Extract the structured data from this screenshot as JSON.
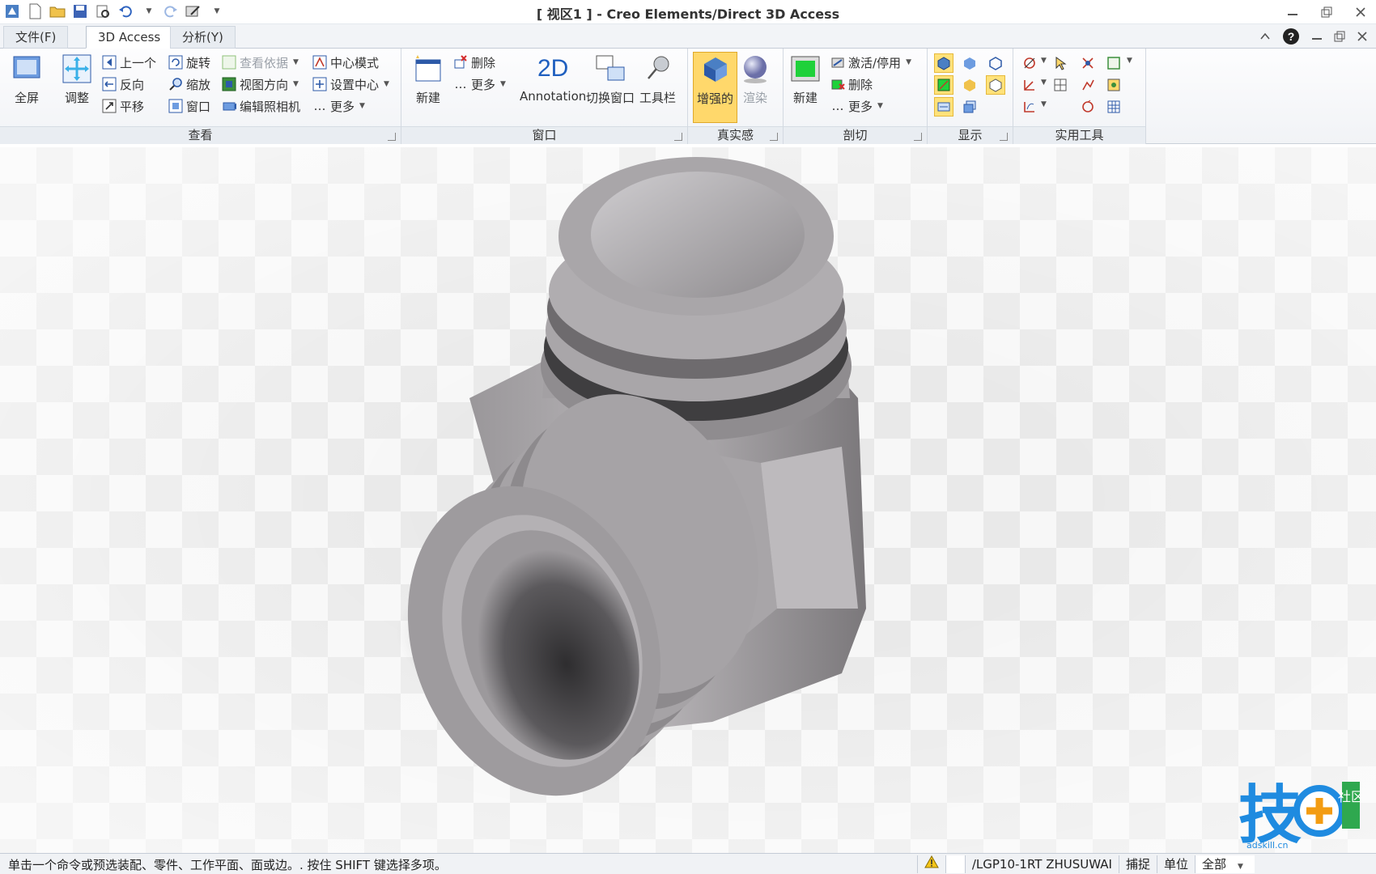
{
  "window": {
    "title": "[ 视区1 ] - Creo Elements/Direct 3D Access"
  },
  "tabs": [
    {
      "label": "文件(F)"
    },
    {
      "label": "3D Access"
    },
    {
      "label": "分析(Y)"
    }
  ],
  "ribbon": {
    "view_group": {
      "label": "查看",
      "fullscreen": "全屏",
      "adjust": "调整",
      "previous": "上一个",
      "reverse": "反向",
      "pan": "平移",
      "rotate": "旋转",
      "zoom": "缩放",
      "window": "窗口",
      "view_by": "查看依据",
      "view_direction": "视图方向",
      "edit_camera": "编辑照相机",
      "center_mode": "中心模式",
      "set_center": "设置中心",
      "more": "更多"
    },
    "window_group": {
      "label": "窗口",
      "new": "新建",
      "delete": "删除",
      "more": "更多",
      "annotation_icon": "2D",
      "annotation": "Annotation",
      "switch_window": "切换窗口",
      "toolbar": "工具栏"
    },
    "realism_group": {
      "label": "真实感",
      "enhanced": "增强的",
      "render": "渲染"
    },
    "section_group": {
      "label": "剖切",
      "new": "新建",
      "activate": "激活/停用",
      "delete": "删除",
      "more": "更多"
    },
    "display_group": {
      "label": "显示"
    },
    "utility_group": {
      "label": "实用工具"
    }
  },
  "status": {
    "message": "单击一个命令或预选装配、零件、工作平面、面或边。. 按住 SHIFT 键选择多项。",
    "path": "/LGP10-1RT ZHUSUWAI",
    "snap": "捕捉",
    "unit": "单位",
    "filter": "全部"
  },
  "watermark": {
    "text": "技",
    "side": "社区",
    "url": "adskill.cn"
  },
  "colors": {
    "accent": "#1f5fbf",
    "highlight": "#ffe27a",
    "model": "#8c8a8c"
  }
}
